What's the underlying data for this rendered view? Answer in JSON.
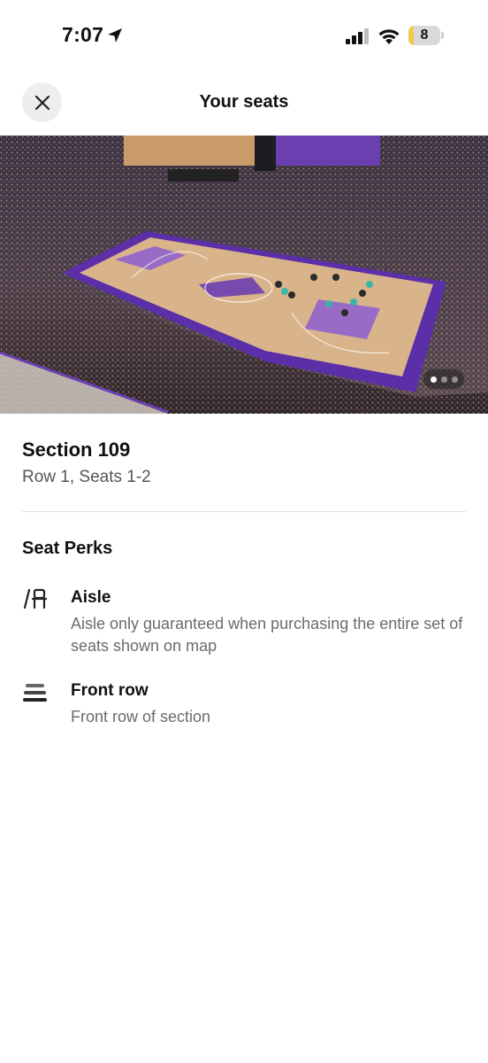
{
  "status_bar": {
    "time": "7:07",
    "battery_level": "8",
    "icons": [
      "location-arrow-icon",
      "cellular-signal-icon",
      "wifi-icon",
      "battery-icon"
    ]
  },
  "header": {
    "title": "Your seats",
    "close_icon": "close-icon"
  },
  "seat_view": {
    "carousel_pages": 3,
    "active_page": 1
  },
  "section": {
    "title": "Section 109",
    "subtitle": "Row 1, Seats 1-2"
  },
  "perks": {
    "heading": "Seat Perks",
    "items": [
      {
        "icon": "aisle-seat-icon",
        "title": "Aisle",
        "description": "Aisle only guaranteed when purchasing the entire set of seats shown on map"
      },
      {
        "icon": "front-row-icon",
        "title": "Front row",
        "description": "Front row of section"
      }
    ]
  },
  "colors": {
    "accent_purple": "#6b3fb0",
    "court_wood": "#d9b48a",
    "text_primary": "#111111",
    "text_secondary": "#6b6b6b"
  }
}
